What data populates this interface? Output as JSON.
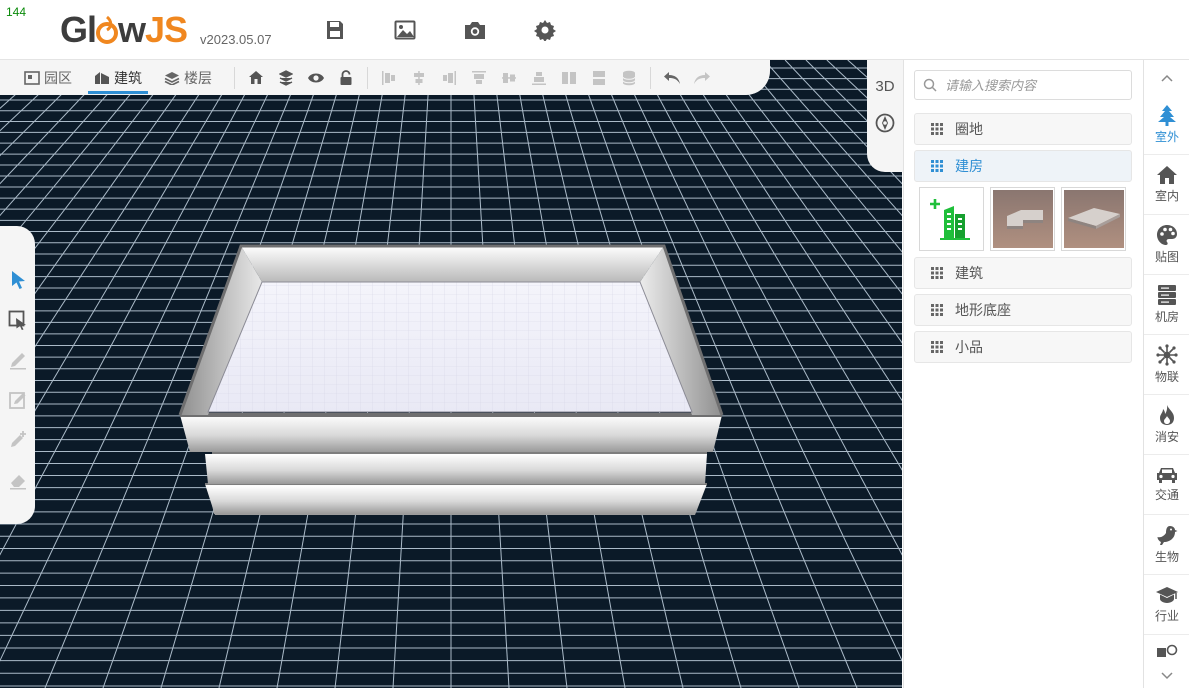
{
  "app": {
    "fps_counter": "144",
    "logo_part1": "Gl",
    "logo_part2": "w",
    "logo_part3": "JS",
    "version": "v2023.05.07",
    "top_tools": [
      "save-icon",
      "image-icon",
      "camera-icon",
      "settings-icon"
    ]
  },
  "toolbar": {
    "tabs": [
      {
        "label": "园区",
        "icon": "park-icon",
        "active": false
      },
      {
        "label": "建筑",
        "icon": "building-icon",
        "active": true
      },
      {
        "label": "楼层",
        "icon": "layers-icon",
        "active": false
      }
    ],
    "view_tools": [
      "home-icon",
      "stack-icon",
      "eye-icon",
      "lock-icon"
    ],
    "align_tools": [
      "align-left-icon",
      "align-center-v-icon",
      "align-right-icon",
      "align-top-icon",
      "align-middle-icon",
      "align-bottom-icon",
      "distribute-h-icon",
      "distribute-v-icon",
      "database-icon"
    ],
    "undo_icon": "undo-icon",
    "redo_icon": "redo-icon"
  },
  "left_tools": [
    "select-arrow-icon",
    "box-select-icon",
    "pen-icon",
    "edit-icon",
    "pen-add-icon",
    "eraser-icon"
  ],
  "view_col": {
    "mode_label": "3D",
    "compass_icon": "compass-icon"
  },
  "panel": {
    "search_placeholder": "请输入搜索内容",
    "groups": [
      {
        "label": "圈地",
        "active": false
      },
      {
        "label": "建房",
        "active": true
      },
      {
        "label": "建筑",
        "active": false
      },
      {
        "label": "地形底座",
        "active": false
      },
      {
        "label": "小品",
        "active": false
      }
    ],
    "thumbnails": [
      "add-building-icon",
      "l-shaped-slab",
      "rectangular-slab"
    ]
  },
  "categories": [
    {
      "label": "室外",
      "icon": "tree-icon",
      "active": true
    },
    {
      "label": "室内",
      "icon": "house-icon",
      "active": false
    },
    {
      "label": "贴图",
      "icon": "palette-icon",
      "active": false
    },
    {
      "label": "机房",
      "icon": "server-icon",
      "active": false
    },
    {
      "label": "物联",
      "icon": "iot-icon",
      "active": false
    },
    {
      "label": "消安",
      "icon": "fire-icon",
      "active": false
    },
    {
      "label": "交通",
      "icon": "car-icon",
      "active": false
    },
    {
      "label": "生物",
      "icon": "bird-icon",
      "active": false
    },
    {
      "label": "行业",
      "icon": "graduation-cap-icon",
      "active": false
    },
    {
      "label": "",
      "icon": "shapes-icon",
      "active": false
    }
  ],
  "colors": {
    "accent": "#2f8fd4",
    "logo_orange": "#f0871f",
    "scene_bg": "#0b1a28",
    "grid_line": "#c8d8e6"
  }
}
